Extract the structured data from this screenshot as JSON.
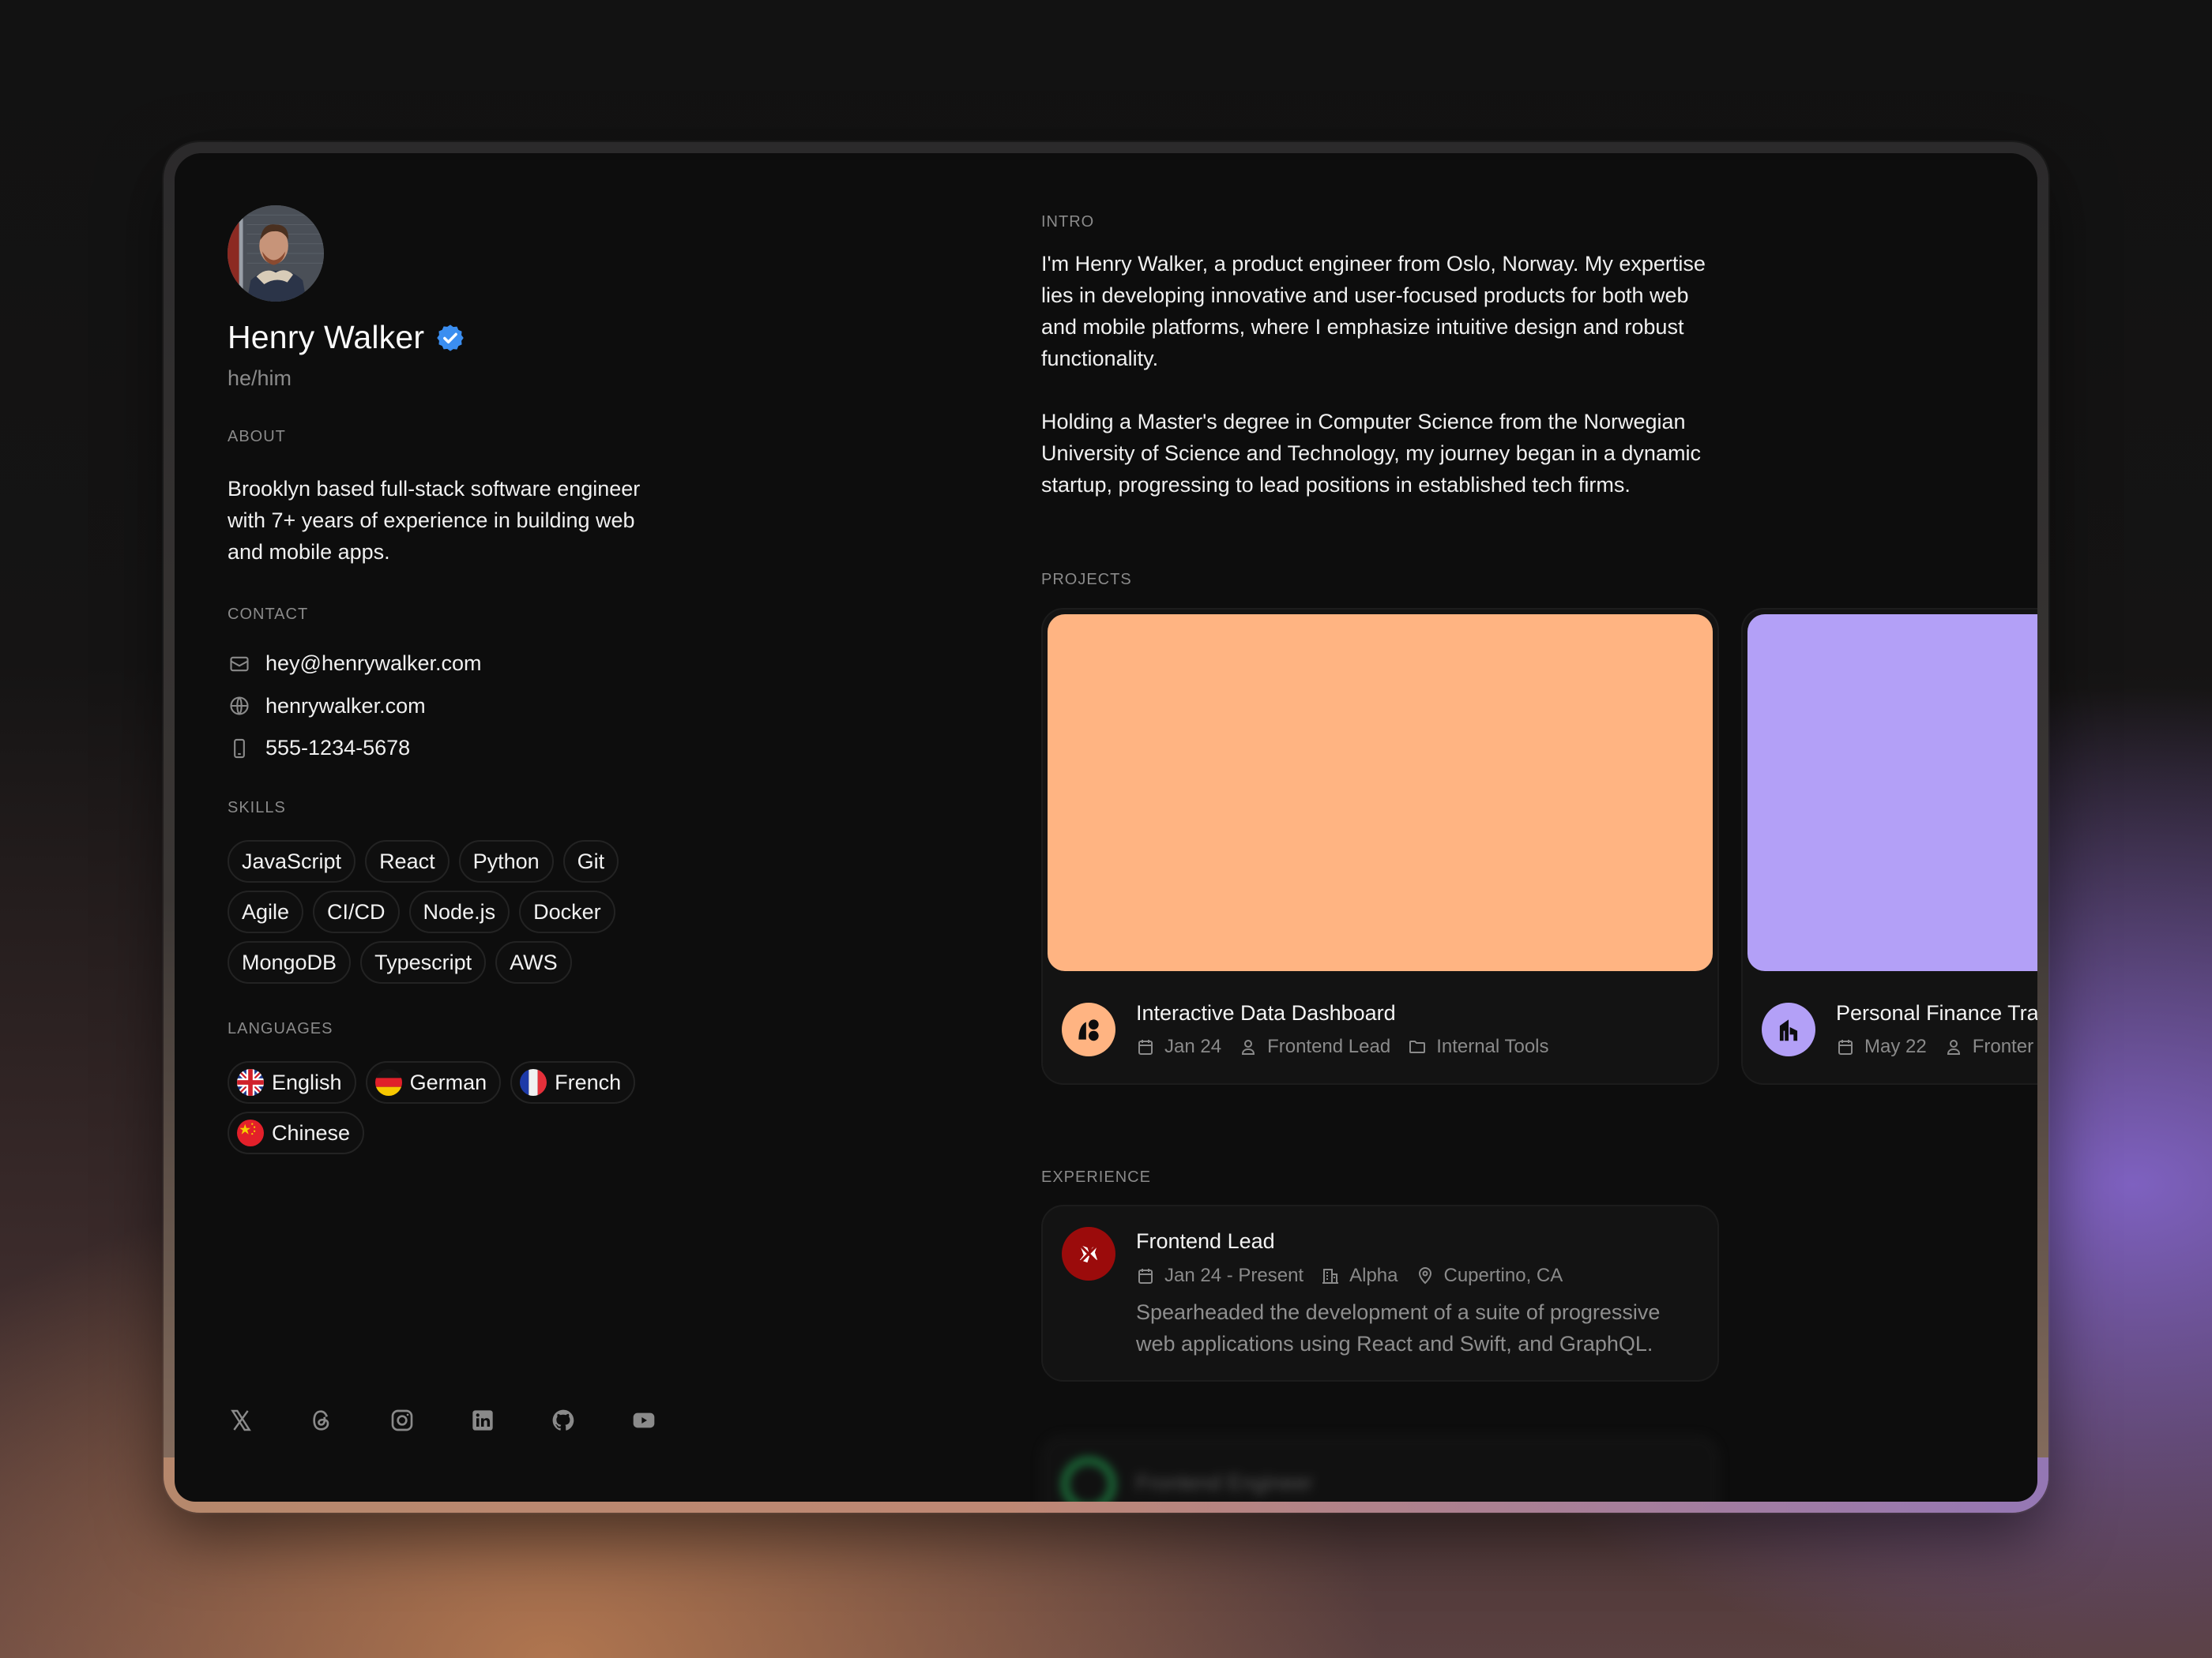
{
  "profile": {
    "name": "Henry Walker",
    "pronouns": "he/him",
    "verified": true
  },
  "about": {
    "label": "ABOUT",
    "text": "Brooklyn based full-stack software engineer with 7+ years of experience in building web and mobile apps."
  },
  "contact": {
    "label": "CONTACT",
    "items": [
      {
        "icon": "mail-icon",
        "value": "hey@henrywalker.com"
      },
      {
        "icon": "globe-icon",
        "value": "henrywalker.com"
      },
      {
        "icon": "phone-icon",
        "value": "555-1234-5678"
      }
    ]
  },
  "skills": {
    "label": "SKILLS",
    "items": [
      "JavaScript",
      "React",
      "Python",
      "Git",
      "Agile",
      "CI/CD",
      "Node.js",
      "Docker",
      "MongoDB",
      "Typescript",
      "AWS"
    ]
  },
  "languages": {
    "label": "LANGUAGES",
    "items": [
      {
        "name": "English",
        "flag": "uk-flag-icon"
      },
      {
        "name": "German",
        "flag": "germany-flag-icon"
      },
      {
        "name": "French",
        "flag": "france-flag-icon"
      },
      {
        "name": "Chinese",
        "flag": "china-flag-icon"
      }
    ]
  },
  "socials": [
    "x-icon",
    "threads-icon",
    "instagram-icon",
    "linkedin-icon",
    "github-icon",
    "youtube-icon"
  ],
  "intro": {
    "label": "INTRO",
    "paragraphs": [
      "I'm Henry Walker, a product engineer from Oslo, Norway. My expertise lies in developing innovative and user-focused products for both web and mobile platforms, where I emphasize intuitive design and robust functionality.",
      "Holding a Master's degree in Computer Science from the Norwegian University of Science and Technology, my journey began in a dynamic startup, progressing to lead positions in established tech firms."
    ]
  },
  "projects": {
    "label": "PROJECTS",
    "items": [
      {
        "title": "Interactive Data Dashboard",
        "date": "Jan 24",
        "role": "Frontend Lead",
        "category": "Internal Tools",
        "color": "#ffb482"
      },
      {
        "title": "Personal Finance Tra",
        "date": "May 22",
        "role": "Fronter",
        "category": "",
        "color": "#b3a0f7"
      }
    ]
  },
  "experience": {
    "label": "EXPERIENCE",
    "items": [
      {
        "title": "Frontend Lead",
        "period": "Jan 24 - Present",
        "company": "Alpha",
        "location": "Cupertino, CA",
        "description": "Spearheaded the development of a suite of progressive web applications using React and Swift, and GraphQL.",
        "color": "#9b0b0b"
      },
      {
        "title": "Frontend Engineer",
        "color": "#22a050"
      }
    ]
  },
  "colors": {
    "background": "#0d0d0d",
    "card": "#131313",
    "muted": "#8a8a8a",
    "verified": "#3b8ef0"
  }
}
